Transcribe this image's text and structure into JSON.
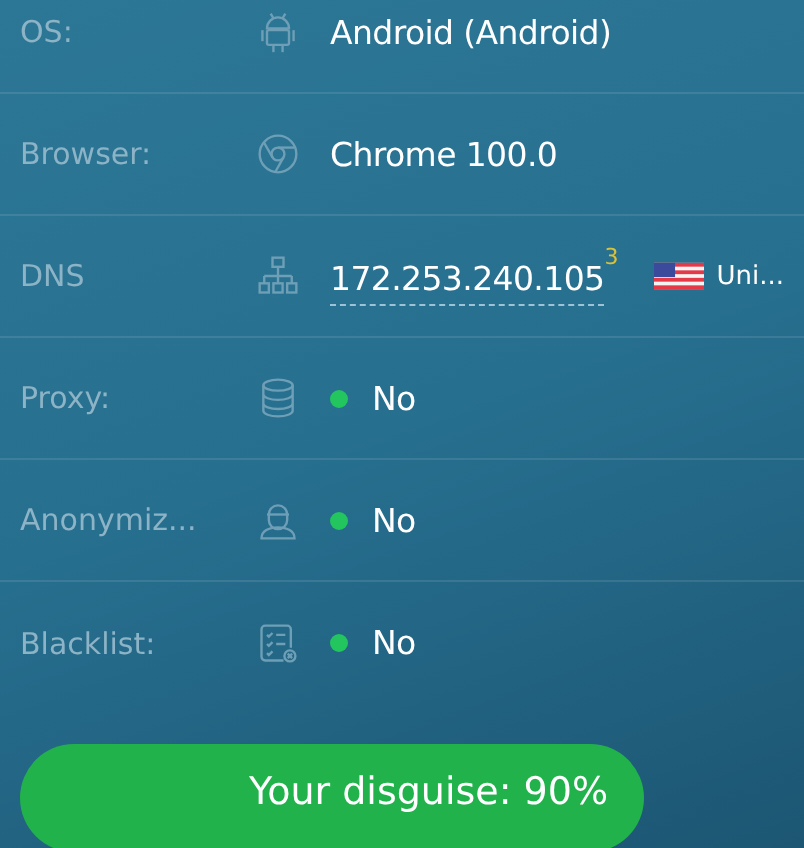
{
  "rows": [
    {
      "kind": "text",
      "label": "OS:",
      "value": "Android (Android)"
    },
    {
      "kind": "text",
      "label": "Browser:",
      "value": "Chrome 100.0"
    },
    {
      "kind": "ip",
      "label": "DNS",
      "value": "172.253.240.105",
      "count": "3",
      "country": "Uni..."
    },
    {
      "kind": "status",
      "label": "Proxy:",
      "value": "No",
      "color": "#22c55e"
    },
    {
      "kind": "status",
      "label": "Anonymiz...",
      "value": "No",
      "color": "#22c55e"
    },
    {
      "kind": "status",
      "label": "Blacklist:",
      "value": "No",
      "color": "#22c55e"
    }
  ],
  "disguise": "Your disguise: 90%"
}
